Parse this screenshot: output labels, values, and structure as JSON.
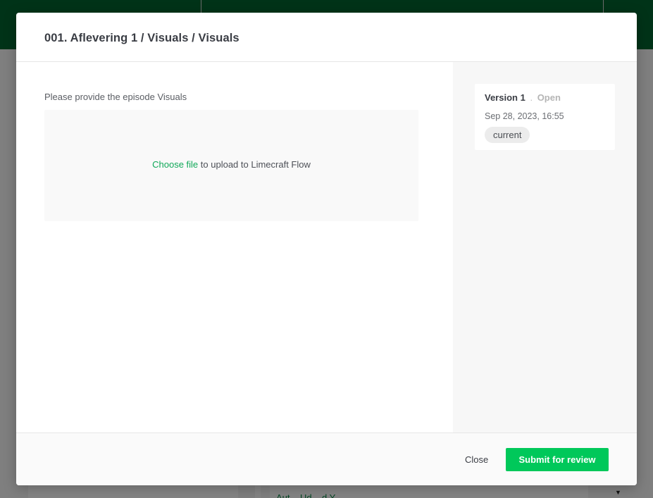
{
  "background": {
    "partial_link": "Aut... Ud... d Y..."
  },
  "modal": {
    "title": "001. Aflevering 1 / Visuals / Visuals",
    "prompt": "Please provide the episode Visuals",
    "dropzone": {
      "choose_file_label": "Choose file",
      "upload_text": " to upload to Limecraft Flow"
    },
    "versions": [
      {
        "name": "Version 1",
        "separator": ".",
        "status": "Open",
        "date": "Sep 28, 2023, 16:55",
        "badge": "current"
      }
    ],
    "footer": {
      "close_label": "Close",
      "submit_label": "Submit for review"
    }
  },
  "colors": {
    "brand_green": "#00632f",
    "accent_green": "#00c85a",
    "link_green": "#0fa858"
  }
}
